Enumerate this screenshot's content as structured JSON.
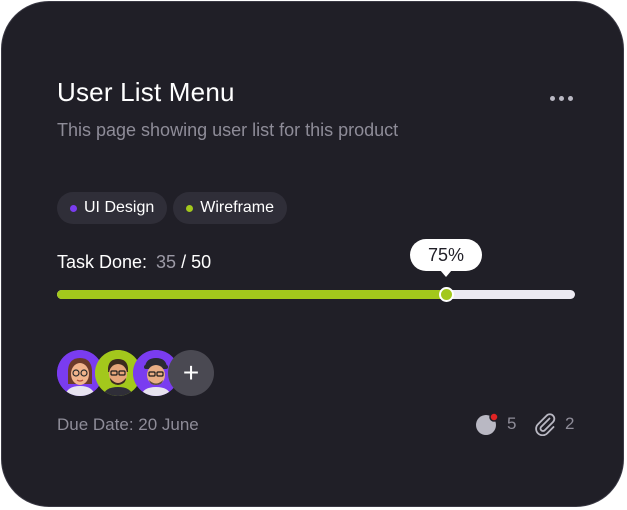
{
  "card": {
    "title": "User List Menu",
    "subtitle": "This page showing user list for this product",
    "more_icon": "more-dots-icon"
  },
  "tags": [
    {
      "label": "UI Design",
      "dot_color": "#7a3cf0"
    },
    {
      "label": "Wireframe",
      "dot_color": "#a3c81c"
    }
  ],
  "task": {
    "label": "Task Done:",
    "done": "35",
    "separator": "/",
    "total": "50",
    "percent_label": "75%",
    "progress_fraction": 0.75,
    "fill_color": "#a3c81c"
  },
  "members": {
    "avatars": [
      {
        "name": "avatar-1",
        "bg": "#7a3cf0"
      },
      {
        "name": "avatar-2",
        "bg": "#a3c81c"
      },
      {
        "name": "avatar-3",
        "bg": "#7a3cf0"
      }
    ],
    "add_label": "+"
  },
  "footer": {
    "due_date": "Due Date: 20 June",
    "comments_count": "5",
    "comments_icon": "comment-icon",
    "attachments_count": "2",
    "attachments_icon": "paperclip-icon",
    "notification_color": "#e02424"
  }
}
